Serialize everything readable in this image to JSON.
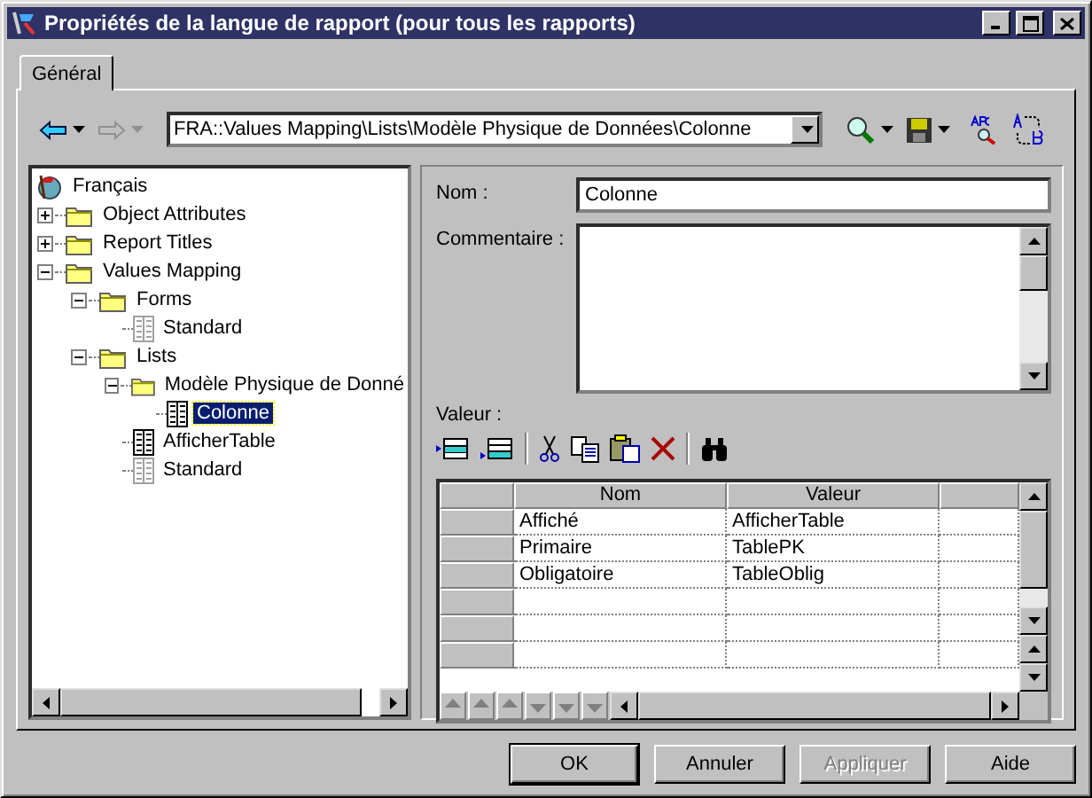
{
  "window": {
    "title": "Propriétés de la langue de rapport (pour tous les rapports)"
  },
  "tabs": [
    {
      "label": "Général",
      "selected": true
    }
  ],
  "toolbar": {
    "path": "FRA::Values Mapping\\Lists\\Modèle Physique de Données\\Colonne"
  },
  "tree": [
    {
      "label": "Français",
      "kind": "root",
      "selected": false,
      "children": [
        {
          "label": "Object Attributes",
          "kind": "folder",
          "expanded": false,
          "selected": false
        },
        {
          "label": "Report Titles",
          "kind": "folder",
          "expanded": false,
          "selected": false
        },
        {
          "label": "Values Mapping",
          "kind": "folder",
          "expanded": true,
          "selected": false,
          "children": [
            {
              "label": "Forms",
              "kind": "folder",
              "expanded": true,
              "selected": false,
              "children": [
                {
                  "label": "Standard",
                  "kind": "table",
                  "dimmed": true,
                  "selected": false
                }
              ]
            },
            {
              "label": "Lists",
              "kind": "folder",
              "expanded": true,
              "selected": false,
              "children": [
                {
                  "label": "Modèle Physique de Donné",
                  "kind": "folder",
                  "expanded": true,
                  "selected": false,
                  "children": [
                    {
                      "label": "Colonne",
                      "kind": "table",
                      "dimmed": false,
                      "selected": true
                    }
                  ]
                },
                {
                  "label": "AfficherTable",
                  "kind": "table",
                  "dimmed": false,
                  "selected": false
                },
                {
                  "label": "Standard",
                  "kind": "table",
                  "dimmed": true,
                  "selected": false
                }
              ]
            }
          ]
        }
      ]
    }
  ],
  "form": {
    "name_label": "Nom :",
    "name_value": "Colonne",
    "comment_label": "Commentaire :",
    "value_label": "Valeur :"
  },
  "table": {
    "columns": [
      "Nom",
      "Valeur"
    ],
    "rows": [
      {
        "nom": "Affiché",
        "valeur": "AfficherTable"
      },
      {
        "nom": "Primaire",
        "valeur": "TablePK"
      },
      {
        "nom": "Obligatoire",
        "valeur": "TableOblig"
      }
    ]
  },
  "buttons": [
    {
      "label": "OK",
      "default": true,
      "disabled": false
    },
    {
      "label": "Annuler",
      "default": false,
      "disabled": false
    },
    {
      "label": "Appliquer",
      "default": false,
      "disabled": true
    },
    {
      "label": "Aide",
      "default": false,
      "disabled": false
    }
  ]
}
